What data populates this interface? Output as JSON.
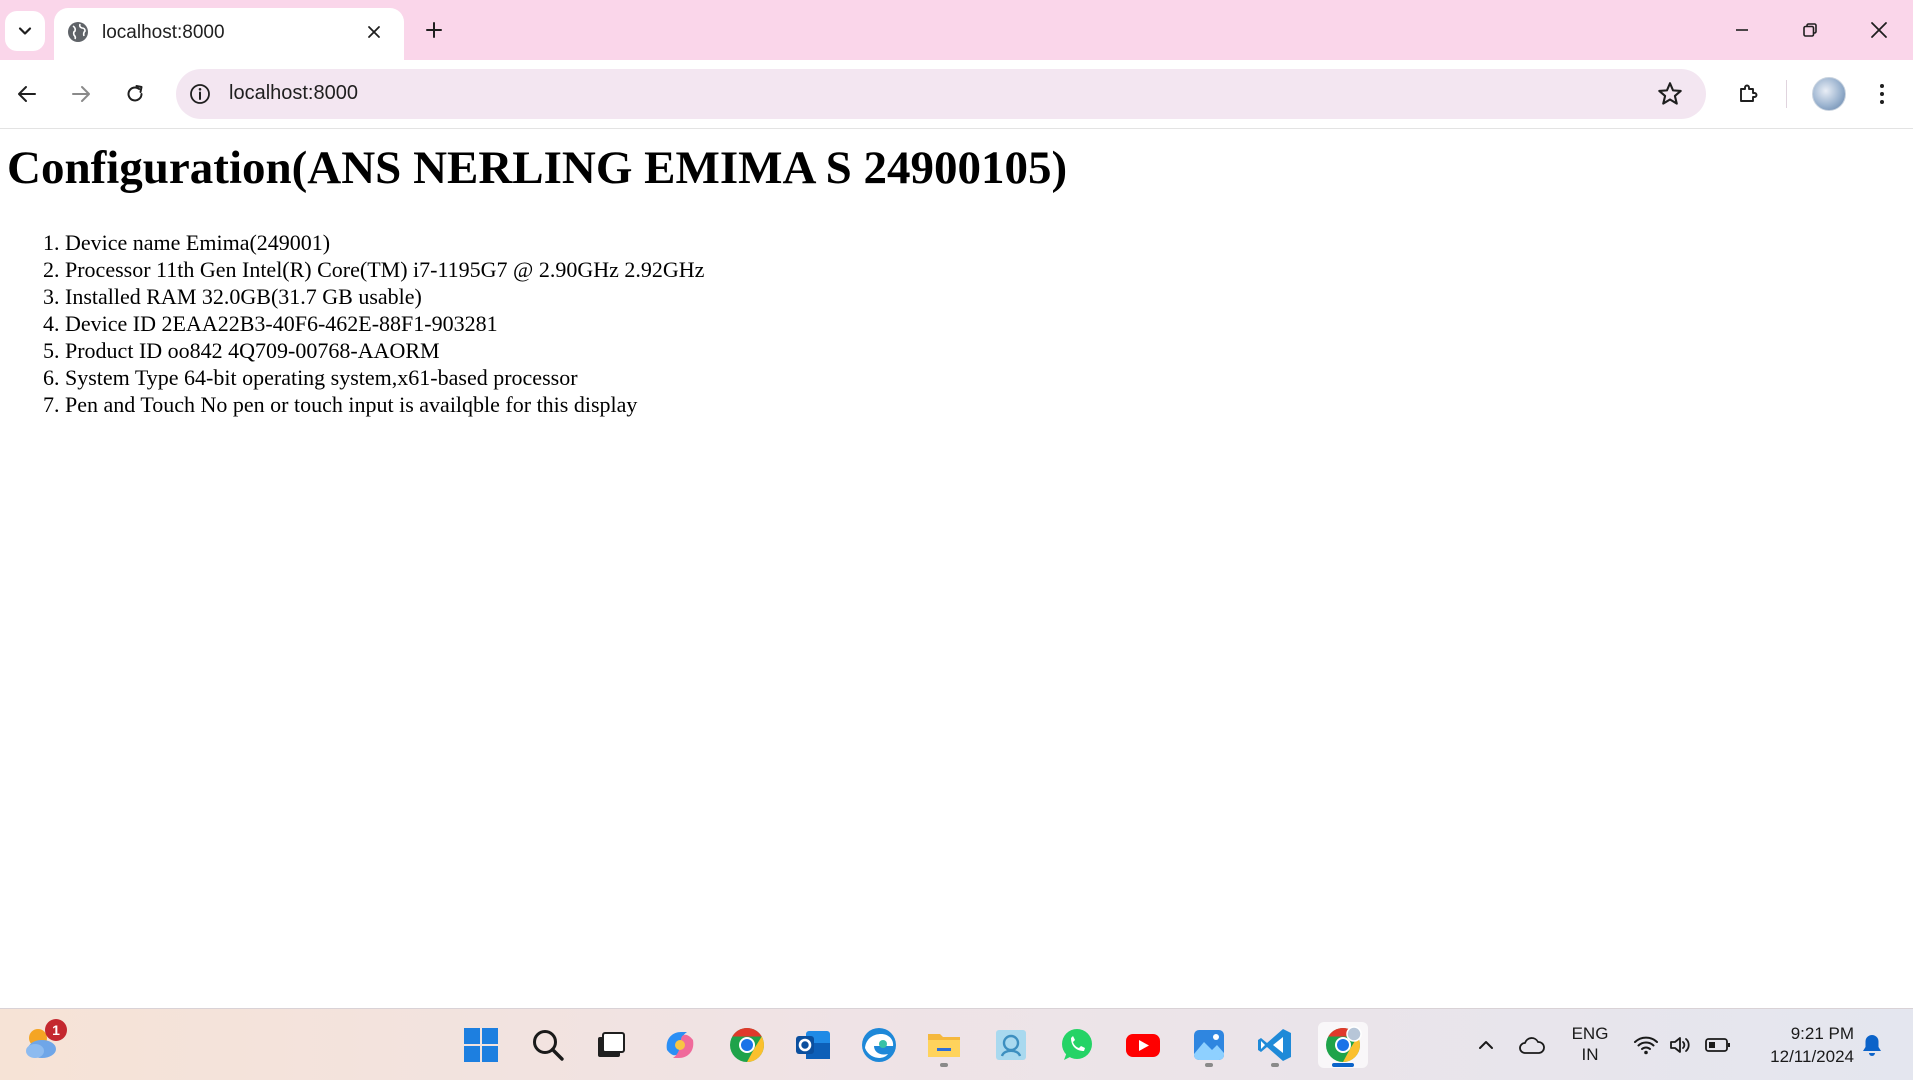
{
  "browser": {
    "tab_title": "localhost:8000",
    "url": "localhost:8000"
  },
  "page": {
    "heading": "Configuration(ANS NERLING EMIMA S 24900105)",
    "items": [
      "Device name Emima(249001)",
      "Processor 11th Gen Intel(R) Core(TM) i7-1195G7 @ 2.90GHz 2.92GHz",
      "Installed RAM 32.0GB(31.7 GB usable)",
      "Device ID 2EAA22B3-40F6-462E-88F1-903281",
      "Product ID oo842 4Q709-00768-AAORM",
      "System Type 64-bit operating system,x61-based processor",
      "Pen and Touch No pen or touch input is availqble for this display"
    ]
  },
  "taskbar": {
    "weather_badge": "1",
    "language_line1": "ENG",
    "language_line2": "IN",
    "time": "9:21 PM",
    "date": "12/11/2024"
  },
  "colors": {
    "tabstrip": "#fad6ea",
    "omnibox": "#f3e6f1",
    "accent": "#0b63c9"
  }
}
